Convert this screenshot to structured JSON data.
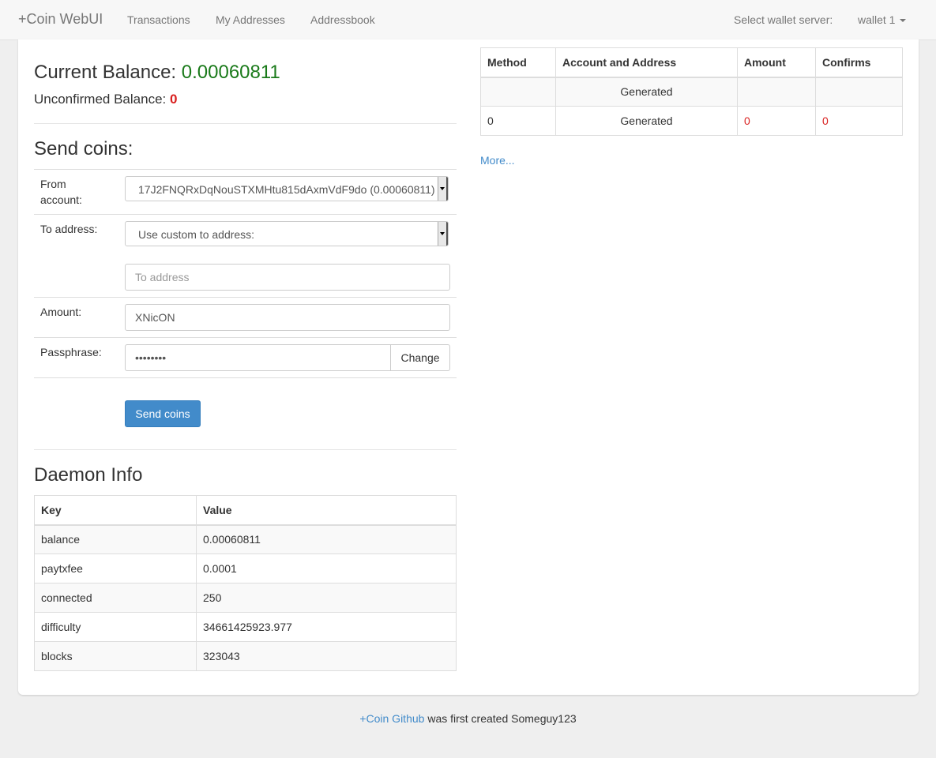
{
  "navbar": {
    "brand": "+Coin WebUI",
    "links": [
      "Transactions",
      "My Addresses",
      "Addressbook"
    ],
    "server_label": "Select wallet server:",
    "server_value": "wallet 1"
  },
  "balance": {
    "current_label": "Current Balance:",
    "current_value": "0.00060811",
    "unconfirmed_label": "Unconfirmed Balance:",
    "unconfirmed_value": "0"
  },
  "send": {
    "heading": "Send coins:",
    "from_label": "From account:",
    "from_value": "17J2FNQRxDqNouSTXMHtu815dAxmVdF9do (0.00060811)",
    "to_label": "To address:",
    "to_select_value": "Use custom to address:",
    "to_placeholder": "To address",
    "amount_label": "Amount:",
    "amount_value": "XNicON",
    "passphrase_label": "Passphrase:",
    "passphrase_value": "••••••••",
    "change_label": "Change",
    "submit_label": "Send coins"
  },
  "daemon": {
    "heading": "Daemon Info",
    "columns": [
      "Key",
      "Value"
    ],
    "rows": [
      {
        "key": "balance",
        "value": "0.00060811"
      },
      {
        "key": "paytxfee",
        "value": "0.0001"
      },
      {
        "key": "connected",
        "value": "250"
      },
      {
        "key": "difficulty",
        "value": "34661425923.977"
      },
      {
        "key": "blocks",
        "value": "323043"
      }
    ]
  },
  "transactions": {
    "columns": [
      "Method",
      "Account and Address",
      "Amount",
      "Confirms"
    ],
    "rows": [
      {
        "method": "",
        "account": "Generated",
        "amount": "",
        "confirms": ""
      },
      {
        "method": "0",
        "account": "Generated",
        "amount": "0",
        "confirms": "0"
      }
    ],
    "more_label": "More..."
  },
  "footer": {
    "link_text": "+Coin Github",
    "text": "was first created Someguy123"
  }
}
